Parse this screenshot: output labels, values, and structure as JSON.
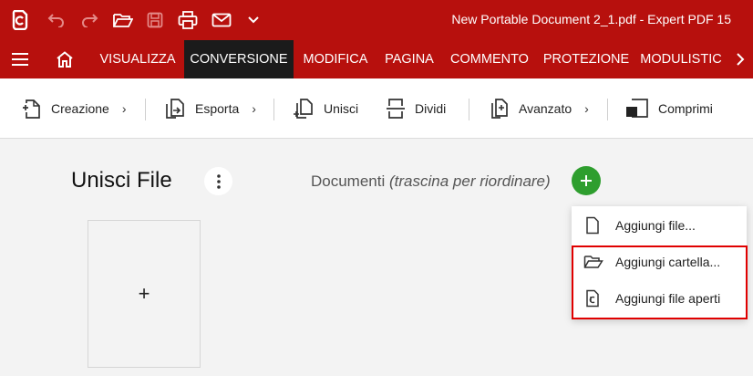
{
  "window": {
    "title": "New Portable Document 2_1.pdf  -  Expert PDF 15"
  },
  "quick_access": [
    "app-logo-icon",
    "undo-icon",
    "redo-icon",
    "open-folder-icon",
    "save-icon",
    "print-icon",
    "mail-icon",
    "chevron-down-icon"
  ],
  "menu": {
    "tabs": [
      {
        "label": "VISUALIZZA",
        "active": false
      },
      {
        "label": "CONVERSIONE",
        "active": true
      },
      {
        "label": "MODIFICA",
        "active": false
      },
      {
        "label": "PAGINA",
        "active": false
      },
      {
        "label": "COMMENTO",
        "active": false
      },
      {
        "label": "PROTEZIONE",
        "active": false
      },
      {
        "label": "MODULISTIC",
        "active": false
      }
    ]
  },
  "ribbon": {
    "creazione": "Creazione",
    "esporta": "Esporta",
    "unisci": "Unisci",
    "dividi": "Dividi",
    "avanzato": "Avanzato",
    "comprimi": "Comprimi",
    "chevron": "›"
  },
  "panel": {
    "title": "Unisci File",
    "documents_label": "Documenti",
    "documents_hint": "(trascina per riordinare)",
    "dropzone_symbol": "+"
  },
  "dropdown": {
    "items": [
      {
        "label": "Aggiungi file...",
        "icon": "file-icon"
      },
      {
        "label": "Aggiungi cartella...",
        "icon": "folder-icon"
      },
      {
        "label": "Aggiungi file aperti",
        "icon": "open-files-icon"
      }
    ]
  },
  "colors": {
    "brand_red": "#b7100d",
    "active_tab": "#1b1b1b",
    "add_green": "#2e9e2e",
    "highlight": "#e00000"
  }
}
